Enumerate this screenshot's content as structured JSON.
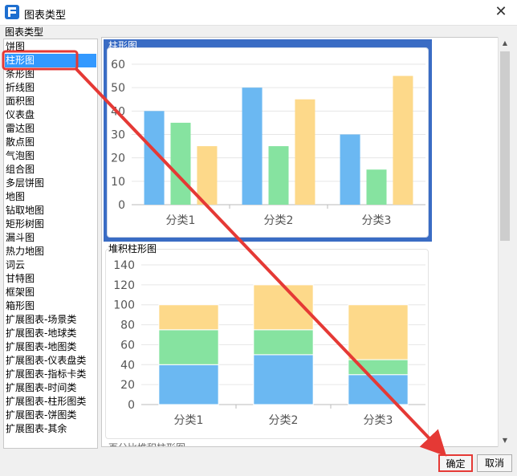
{
  "window": {
    "title": "图表类型",
    "close_glyph": "✕"
  },
  "group_label": "图表类型",
  "chart_types": [
    "饼图",
    "柱形图",
    "条形图",
    "折线图",
    "面积图",
    "仪表盘",
    "雷达图",
    "散点图",
    "气泡图",
    "组合图",
    "多层饼图",
    "地图",
    "钻取地图",
    "矩形树图",
    "漏斗图",
    "热力地图",
    "词云",
    "甘特图",
    "框架图",
    "箱形图",
    "扩展图表-场景类",
    "扩展图表-地球类",
    "扩展图表-地图类",
    "扩展图表-仪表盘类",
    "扩展图表-指标卡类",
    "扩展图表-时间类",
    "扩展图表-柱形图类",
    "扩展图表-饼图类",
    "扩展图表-其余"
  ],
  "selected_index": 1,
  "preview": {
    "card1_title": "柱形图",
    "card2_title": "堆积柱形图",
    "card3_title": "百分比堆积柱形图"
  },
  "buttons": {
    "ok": "确定",
    "cancel": "取消"
  },
  "colors": {
    "blue": "#6bb8f2",
    "green": "#86e3a0",
    "orange": "#fdd98a",
    "selection": "#3399ff",
    "header_blue": "#3a6cc4",
    "annotation_red": "#e53935"
  },
  "chart_data": [
    {
      "type": "bar",
      "title": "柱形图",
      "categories": [
        "分类1",
        "分类2",
        "分类3"
      ],
      "series": [
        {
          "values": [
            40,
            50,
            30
          ]
        },
        {
          "values": [
            35,
            25,
            15
          ]
        },
        {
          "values": [
            25,
            45,
            55
          ]
        }
      ],
      "ylim": [
        0,
        60
      ],
      "yticks": [
        0,
        10,
        20,
        30,
        40,
        50,
        60
      ],
      "grid": true
    },
    {
      "type": "bar",
      "stacked": true,
      "title": "堆积柱形图",
      "categories": [
        "分类1",
        "分类2",
        "分类3"
      ],
      "series": [
        {
          "values": [
            40,
            50,
            30
          ]
        },
        {
          "values": [
            35,
            25,
            15
          ]
        },
        {
          "values": [
            25,
            45,
            55
          ]
        }
      ],
      "ylim": [
        0,
        140
      ],
      "yticks": [
        0,
        20,
        40,
        60,
        80,
        100,
        120,
        140
      ],
      "grid": true
    }
  ]
}
